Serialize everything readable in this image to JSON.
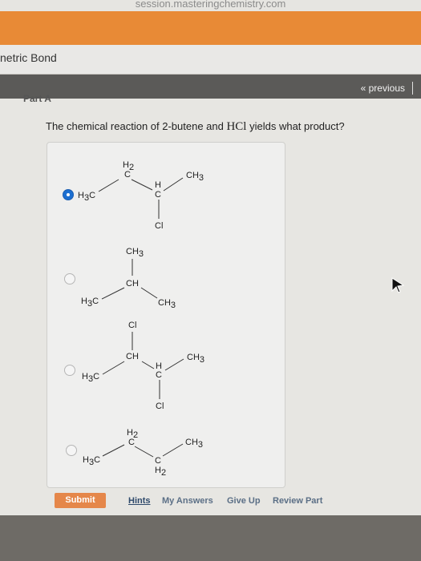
{
  "browser": {
    "url": "session.masteringchemistry.com"
  },
  "assignment": {
    "title_fragment": "netric Bond"
  },
  "nav": {
    "previous_label": "« previous"
  },
  "part": {
    "label": "Part A"
  },
  "question": {
    "text_before": "The chemical reaction of 2-butene and ",
    "reagent": "HCl",
    "text_after": " yields what product?"
  },
  "options": [
    {
      "selected": true,
      "structure": "H3C-CH2-CH(Cl)-CH3"
    },
    {
      "selected": false,
      "structure": "(CH3)2CH-CH3"
    },
    {
      "selected": false,
      "structure": "H3C-CH(Cl)-CH(Cl)-CH3"
    },
    {
      "selected": false,
      "structure": "H3C-CH2-CH2-CH3"
    }
  ],
  "labels": {
    "H": "H",
    "C": "C",
    "Cl": "Cl",
    "CH": "CH",
    "H2": "H",
    "H2_sub": "2",
    "H3C": "H",
    "H3C_sub": "3",
    "H3C_tail": "C",
    "CH3": "CH",
    "CH3_sub": "3"
  },
  "actions": {
    "submit": "Submit",
    "hints": "Hints",
    "my_answers": "My Answers",
    "give_up": "Give Up",
    "review_part": "Review Part"
  }
}
